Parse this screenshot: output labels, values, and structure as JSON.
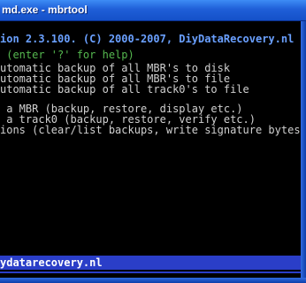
{
  "window": {
    "title": "md.exe - mbrtool"
  },
  "console": {
    "header": "ion 2.3.100. (C) 2000-2007, DiyDataRecovery.nl",
    "help": " (enter '?' for help)",
    "menu_lines": [
      "utomatic backup of all MBR's to disk",
      "utomatic backup of all MBR's to file",
      "utomatic backup of all track0's to file",
      "",
      " a MBR (backup, restore, display etc.)",
      " a track0 (backup, restore, verify etc.)",
      "ions (clear/list backups, write signature bytes"
    ],
    "status": "ydatarecovery.nl"
  },
  "colors": {
    "header_text": "#6aa0ff",
    "help_text": "#55b84f",
    "status_bar": "#2a3ec8"
  }
}
